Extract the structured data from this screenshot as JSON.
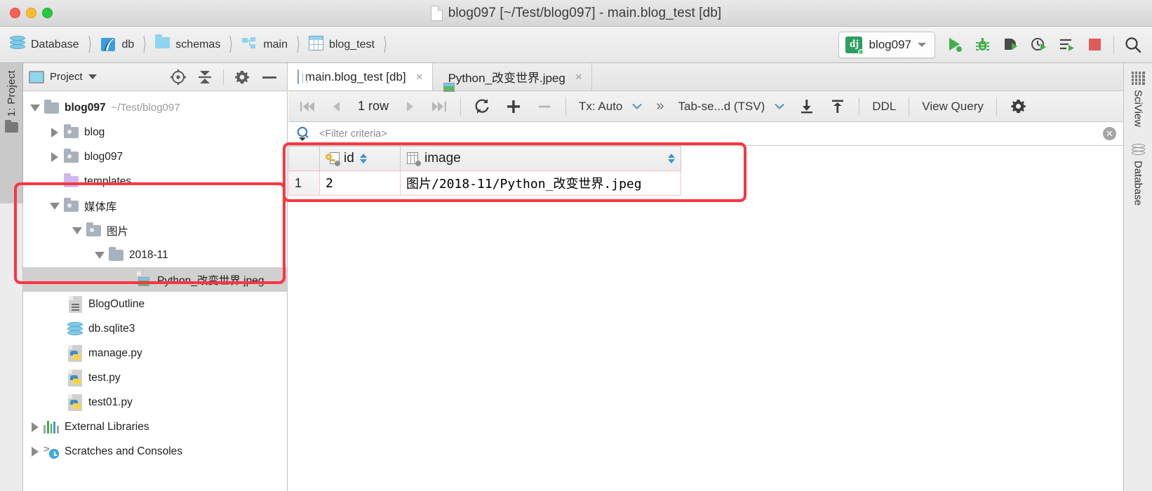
{
  "window": {
    "title": "blog097 [~/Test/blog097] - main.blog_test [db]",
    "accent_red": "#fb3640",
    "traffic_lights": [
      "close",
      "minimize",
      "maximize"
    ]
  },
  "breadcrumbs": [
    {
      "label": "Database",
      "icon": "database-icon"
    },
    {
      "label": "db",
      "icon": "sqlite-icon"
    },
    {
      "label": "schemas",
      "icon": "folder-icon"
    },
    {
      "label": "main",
      "icon": "schema-icon"
    },
    {
      "label": "blog_test",
      "icon": "table-icon"
    }
  ],
  "toolbar": {
    "run_config": {
      "label": "blog097",
      "icon": "django-icon"
    },
    "buttons": [
      {
        "name": "run-button",
        "icon": "run-icon"
      },
      {
        "name": "debug-button",
        "icon": "bug-icon"
      },
      {
        "name": "coverage-button",
        "icon": "coverage-icon"
      },
      {
        "name": "profile-button",
        "icon": "profile-icon"
      },
      {
        "name": "run-manage-task-button",
        "icon": "manage-task-icon"
      },
      {
        "name": "stop-button",
        "icon": "stop-icon"
      },
      {
        "name": "search-everywhere-button",
        "icon": "search-icon"
      }
    ]
  },
  "left_strip": {
    "label": "1: Project",
    "icon": "project-folder-icon"
  },
  "project_panel": {
    "header": {
      "title": "Project",
      "buttons": [
        {
          "name": "select-opened-file-button",
          "icon": "target-icon"
        },
        {
          "name": "collapse-all-button",
          "icon": "collapse-all-icon"
        },
        {
          "name": "settings-button",
          "icon": "gear-icon"
        },
        {
          "name": "hide-button",
          "icon": "minus-icon"
        }
      ]
    },
    "tree": [
      {
        "label": "blog097",
        "path": "~/Test/blog097",
        "icon": "folder-icon",
        "state": "expanded",
        "depth": 0,
        "bold": true,
        "selected": false
      },
      {
        "label": "blog",
        "path": "",
        "icon": "folder-icon",
        "state": "collapsed",
        "depth": 1,
        "bold": false,
        "selected": false
      },
      {
        "label": "blog097",
        "path": "",
        "icon": "folder-icon",
        "state": "collapsed",
        "depth": 1,
        "bold": false,
        "selected": false
      },
      {
        "label": "templates",
        "path": "",
        "icon": "templates-folder-icon",
        "state": "leaf",
        "depth": 1,
        "bold": false,
        "selected": false
      },
      {
        "label": "媒体库",
        "path": "",
        "icon": "folder-icon",
        "state": "expanded",
        "depth": 1,
        "bold": false,
        "selected": false
      },
      {
        "label": "图片",
        "path": "",
        "icon": "folder-icon",
        "state": "expanded",
        "depth": 2,
        "bold": false,
        "selected": false
      },
      {
        "label": "2018-11",
        "path": "",
        "icon": "plain-folder-icon",
        "state": "expanded",
        "depth": 3,
        "bold": false,
        "selected": false
      },
      {
        "label": "Python_改变世界.jpeg",
        "path": "",
        "icon": "image-file-icon",
        "state": "leaf",
        "depth": 4,
        "bold": false,
        "selected": true
      },
      {
        "label": "BlogOutline",
        "path": "",
        "icon": "text-file-icon",
        "state": "leaf",
        "depth": 1,
        "bold": false,
        "selected": false
      },
      {
        "label": "db.sqlite3",
        "path": "",
        "icon": "database-file-icon",
        "state": "leaf",
        "depth": 1,
        "bold": false,
        "selected": false
      },
      {
        "label": "manage.py",
        "path": "",
        "icon": "python-file-icon",
        "state": "leaf",
        "depth": 1,
        "bold": false,
        "selected": false
      },
      {
        "label": "test.py",
        "path": "",
        "icon": "python-file-icon",
        "state": "leaf",
        "depth": 1,
        "bold": false,
        "selected": false
      },
      {
        "label": "test01.py",
        "path": "",
        "icon": "python-file-icon",
        "state": "leaf",
        "depth": 1,
        "bold": false,
        "selected": false
      },
      {
        "label": "External Libraries",
        "path": "",
        "icon": "libraries-icon",
        "state": "collapsed",
        "depth": 0,
        "bold": false,
        "selected": false
      },
      {
        "label": "Scratches and Consoles",
        "path": "",
        "icon": "scratches-icon",
        "state": "collapsed",
        "depth": 0,
        "bold": false,
        "selected": false
      }
    ]
  },
  "editor": {
    "tabs": [
      {
        "label": "main.blog_test [db]",
        "icon": "table-icon",
        "active": true,
        "close": "×"
      },
      {
        "label": "Python_改变世界.jpeg",
        "icon": "image-file-icon",
        "active": false,
        "close": "×"
      }
    ],
    "datagrid_toolbar": {
      "first_page": "|◀◀",
      "prev_page": "◀",
      "row_count": "1 row",
      "next_page": "▶",
      "last_page": "▶▶|",
      "reload": "reload-icon",
      "add_row": "+",
      "delete_row": "−",
      "transaction_label": "Tx: Auto",
      "more_label": "»",
      "format_label": "Tab-se...d (TSV)",
      "import_icon": "import-icon",
      "export_icon": "export-icon",
      "ddl_label": "DDL",
      "view_query_label": "View Query",
      "settings_icon": "gear-icon"
    },
    "filter": {
      "placeholder": "<Filter criteria>",
      "value": "",
      "search_icon": "filter-search-icon",
      "clear_icon": "clear-icon"
    },
    "table": {
      "columns": [
        {
          "label": "id",
          "icon": "primary-key-icon",
          "sortable": true
        },
        {
          "label": "image",
          "icon": "column-icon",
          "sortable": false
        }
      ],
      "rows": [
        {
          "num": "1",
          "id": "2",
          "image": "图片/2018-11/Python_改变世界.jpeg"
        }
      ]
    }
  },
  "right_strip": [
    {
      "label": "SciView",
      "icon": "sciview-icon"
    },
    {
      "label": "Database",
      "icon": "database-icon"
    }
  ],
  "annotations": [
    {
      "name": "tree-media-library-highlight"
    },
    {
      "name": "grid-result-highlight"
    }
  ]
}
